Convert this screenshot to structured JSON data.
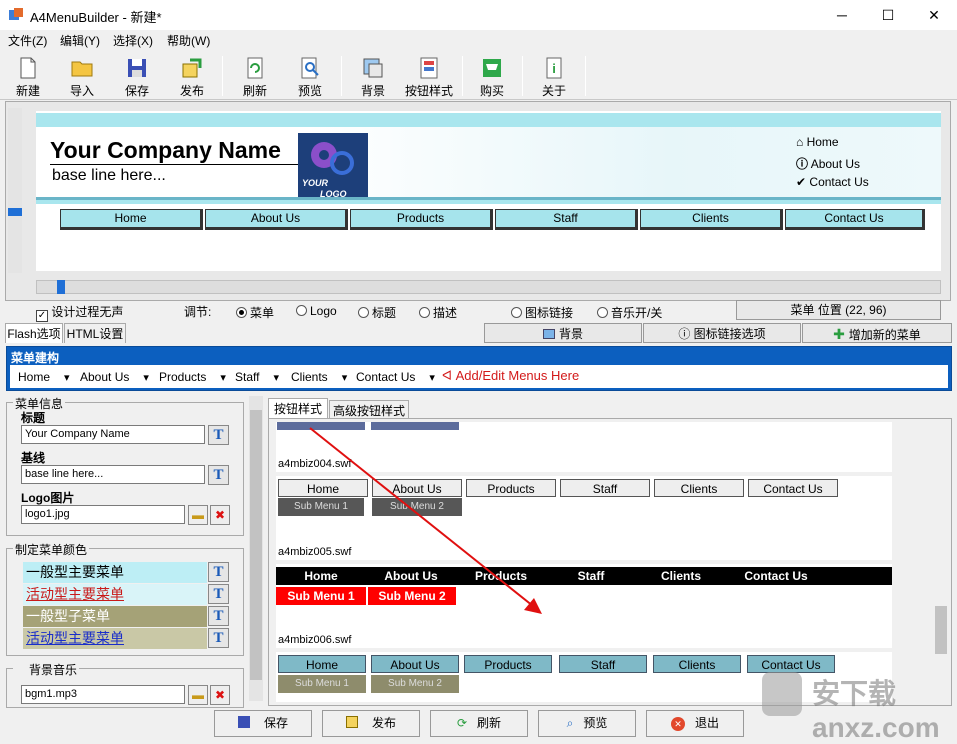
{
  "window": {
    "title": "A4MenuBuilder - 新建*"
  },
  "menubar": [
    "文件(Z)",
    "编辑(Y)",
    "选择(X)",
    "帮助(W)"
  ],
  "toolbar": [
    "新建",
    "导入",
    "保存",
    "发布",
    "刷新",
    "预览",
    "背景",
    "按钮样式",
    "购买",
    "关于"
  ],
  "preview": {
    "company": "Your Company Name",
    "baseline": "base line here...",
    "logo_line1": "YOUR",
    "logo_line2": "LOGO",
    "top_links": [
      "Home",
      "About Us",
      "Contact Us"
    ],
    "menu": [
      "Home",
      "About Us",
      "Products",
      "Staff",
      "Clients",
      "Contact Us"
    ]
  },
  "options": {
    "mute": "设计过程无声",
    "adjust": "调节:",
    "radios": [
      "菜单",
      "Logo",
      "标题",
      "描述",
      "图标链接",
      "音乐开/关"
    ],
    "position": "菜单 位置 (22, 96)"
  },
  "tabs": [
    "Flash选项",
    "HTML设置"
  ],
  "panel_buttons": [
    "背景",
    "图标链接选项",
    "增加新的菜单"
  ],
  "structure": {
    "title": "菜单建构",
    "items": [
      "Home",
      "About Us",
      "Products",
      "Staff",
      "Clients",
      "Contact Us"
    ],
    "add_hint": "Add/Edit Menus Here"
  },
  "menu_info": {
    "group": "菜单信息",
    "title_label": "标题",
    "title_value": "Your Company Name",
    "baseline_label": "基线",
    "baseline_value": "base line here...",
    "logo_label": "Logo图片",
    "logo_value": "logo1.jpg"
  },
  "colors": {
    "group": "制定菜单颜色",
    "rows": [
      "一般型主要菜单",
      "活动型主要菜单",
      "一般型子菜单",
      "活动型主要菜单"
    ]
  },
  "music": {
    "group": "背景音乐",
    "value": "bgm1.mp3"
  },
  "style_tabs": [
    "按钮样式",
    "高级按钮样式"
  ],
  "swfs": {
    "s4": "a4mbiz004.swf",
    "s5": "a4mbiz005.swf",
    "s6": "a4mbiz006.swf",
    "menu": [
      "Home",
      "About Us",
      "Products",
      "Staff",
      "Clients",
      "Contact Us"
    ],
    "sub": [
      "Sub Menu 1",
      "Sub Menu 2"
    ]
  },
  "bottom_buttons": [
    "保存",
    "发布",
    "刷新",
    "预览",
    "退出"
  ],
  "watermark": "安下载 anxz.com"
}
